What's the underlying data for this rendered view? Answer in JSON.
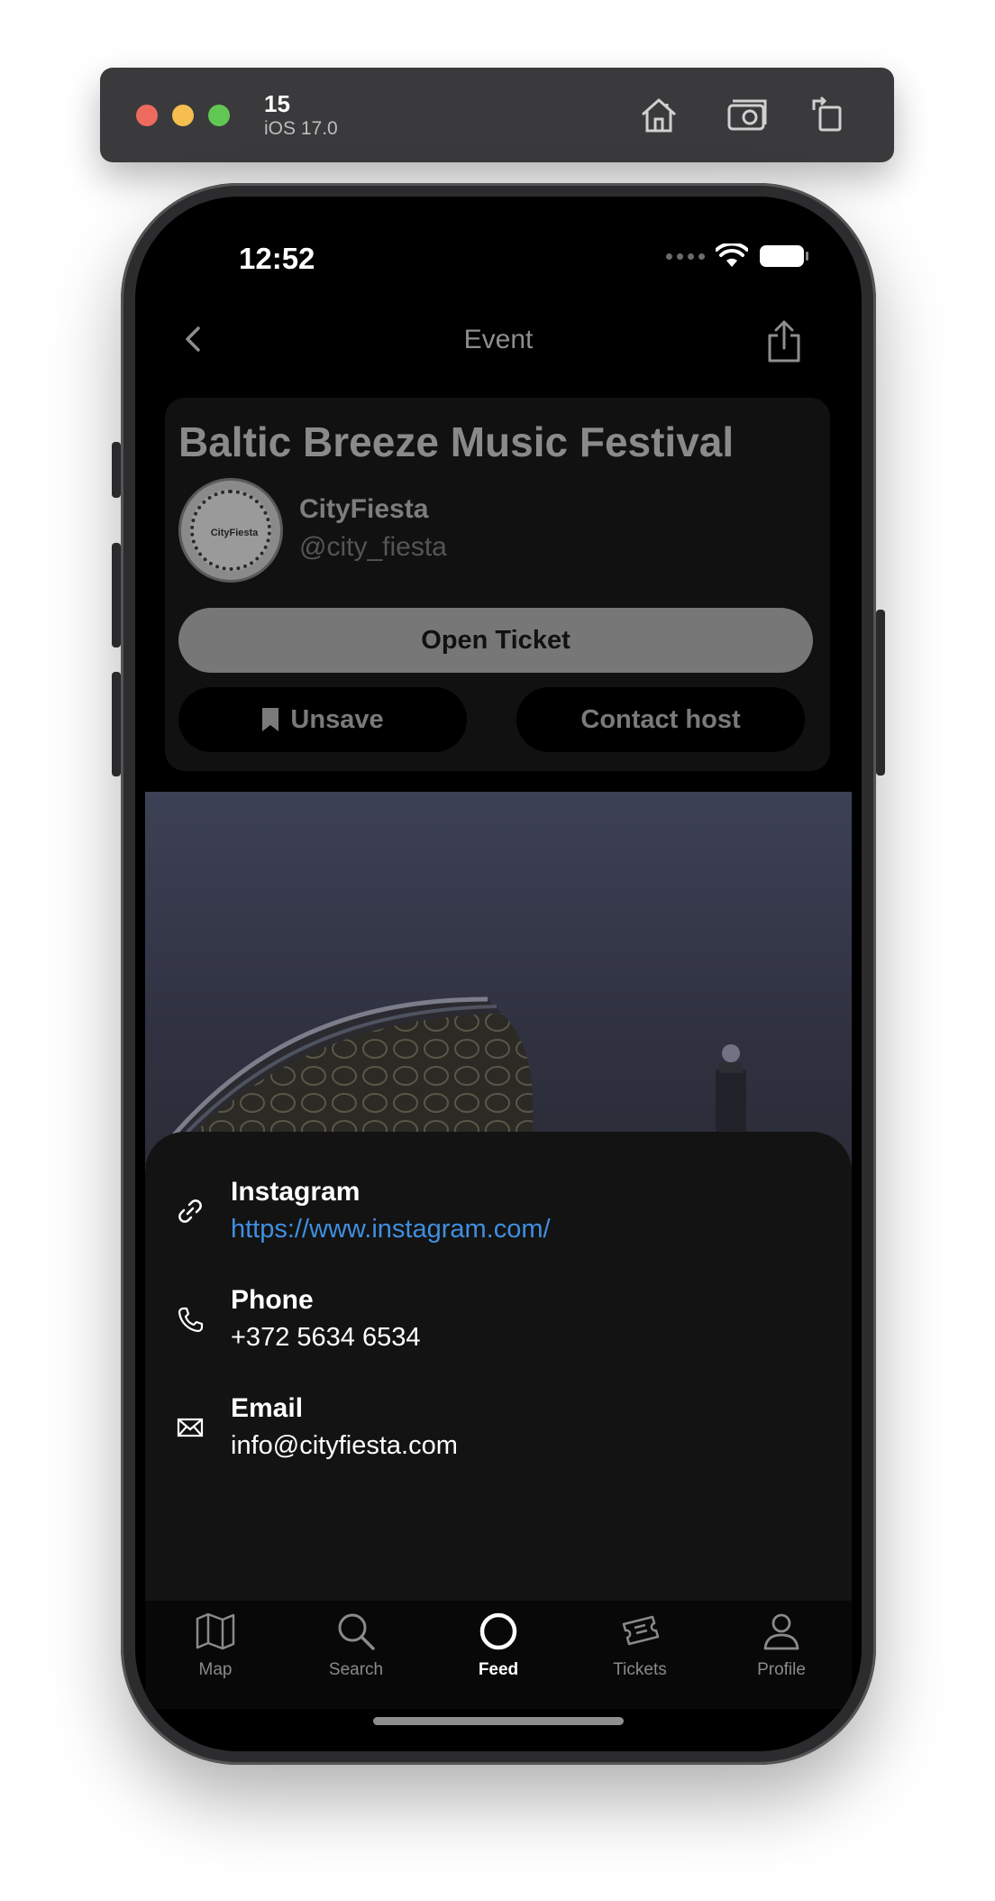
{
  "simulator": {
    "device": "15",
    "os": "iOS 17.0",
    "toolbar_icons": [
      "home-icon",
      "screenshot-icon",
      "rotate-icon"
    ]
  },
  "status_bar": {
    "time": "12:52",
    "icons": [
      "signal-icon",
      "wifi-icon",
      "battery-icon"
    ]
  },
  "header": {
    "title": "Event",
    "back_icon": "chevron-left-icon",
    "share_icon": "share-icon"
  },
  "event": {
    "title": "Baltic Breeze Music Festival",
    "host_name": "CityFiesta",
    "host_handle": "@city_fiesta",
    "avatar_text": "CityFiesta",
    "open_ticket_label": "Open Ticket",
    "unsave_label": "Unsave",
    "contact_host_label": "Contact host"
  },
  "contacts": [
    {
      "label": "Instagram",
      "value": "https://www.instagram.com/",
      "icon": "link-icon"
    },
    {
      "label": "Phone",
      "value": "+372 5634 6534",
      "icon": "phone-icon"
    },
    {
      "label": "Email",
      "value": "info@cityfiesta.com",
      "icon": "mail-icon"
    }
  ],
  "tabs": [
    {
      "label": "Map",
      "icon": "map-icon"
    },
    {
      "label": "Search",
      "icon": "search-icon"
    },
    {
      "label": "Feed",
      "icon": "feed-icon",
      "active": true
    },
    {
      "label": "Tickets",
      "icon": "tickets-icon"
    },
    {
      "label": "Profile",
      "icon": "profile-icon"
    }
  ],
  "colors": {
    "accent_link": "#3f8fe0",
    "sheet_bg": "#131313",
    "screen_bg": "#000000"
  }
}
